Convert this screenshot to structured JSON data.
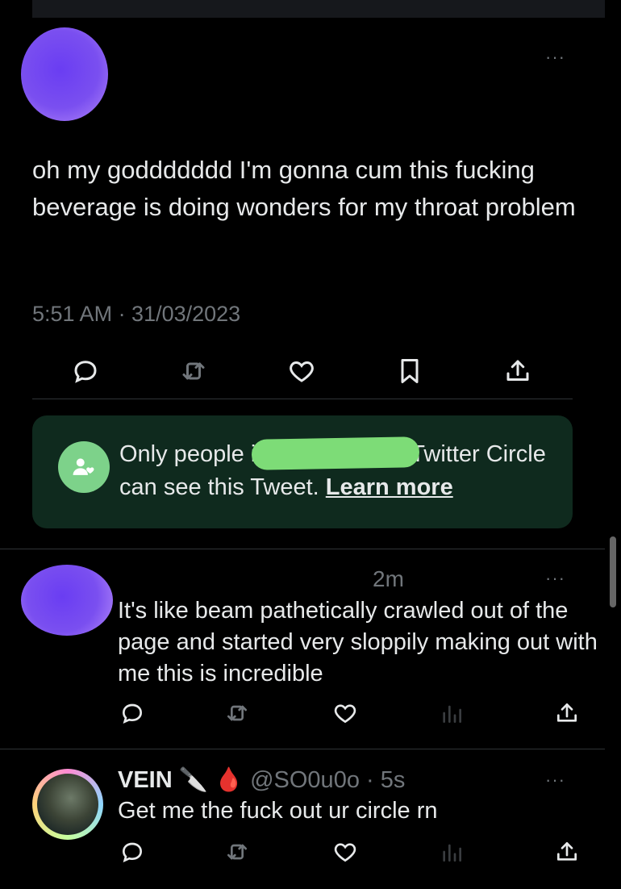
{
  "main_tweet": {
    "text": "oh my goddddddd I'm gonna cum this fucking beverage is doing wonders for my throat problem",
    "timestamp": "5:51 AM · 31/03/2023",
    "more_label": "···"
  },
  "circle_notice": {
    "text_before": "Only people i",
    "text_after": "Twitter Circle can see this Tweet. ",
    "link_label": "Learn more",
    "accent_color": "#7dd28a"
  },
  "reply1": {
    "time": "2m",
    "text": "It's like beam pathetically crawled out of the page and started very sloppily making out with me this is incredible",
    "more_label": "···"
  },
  "reply2": {
    "name": "VEIN",
    "emoji": "🔪 🩸",
    "handle": "@SO0u0o · 5s",
    "text": "Get me the fuck out ur circle rn",
    "more_label": "···"
  },
  "icons": [
    "reply-icon",
    "retweet-icon",
    "like-icon",
    "bookmark-icon",
    "share-icon",
    "views-icon",
    "circle-people-icon"
  ]
}
